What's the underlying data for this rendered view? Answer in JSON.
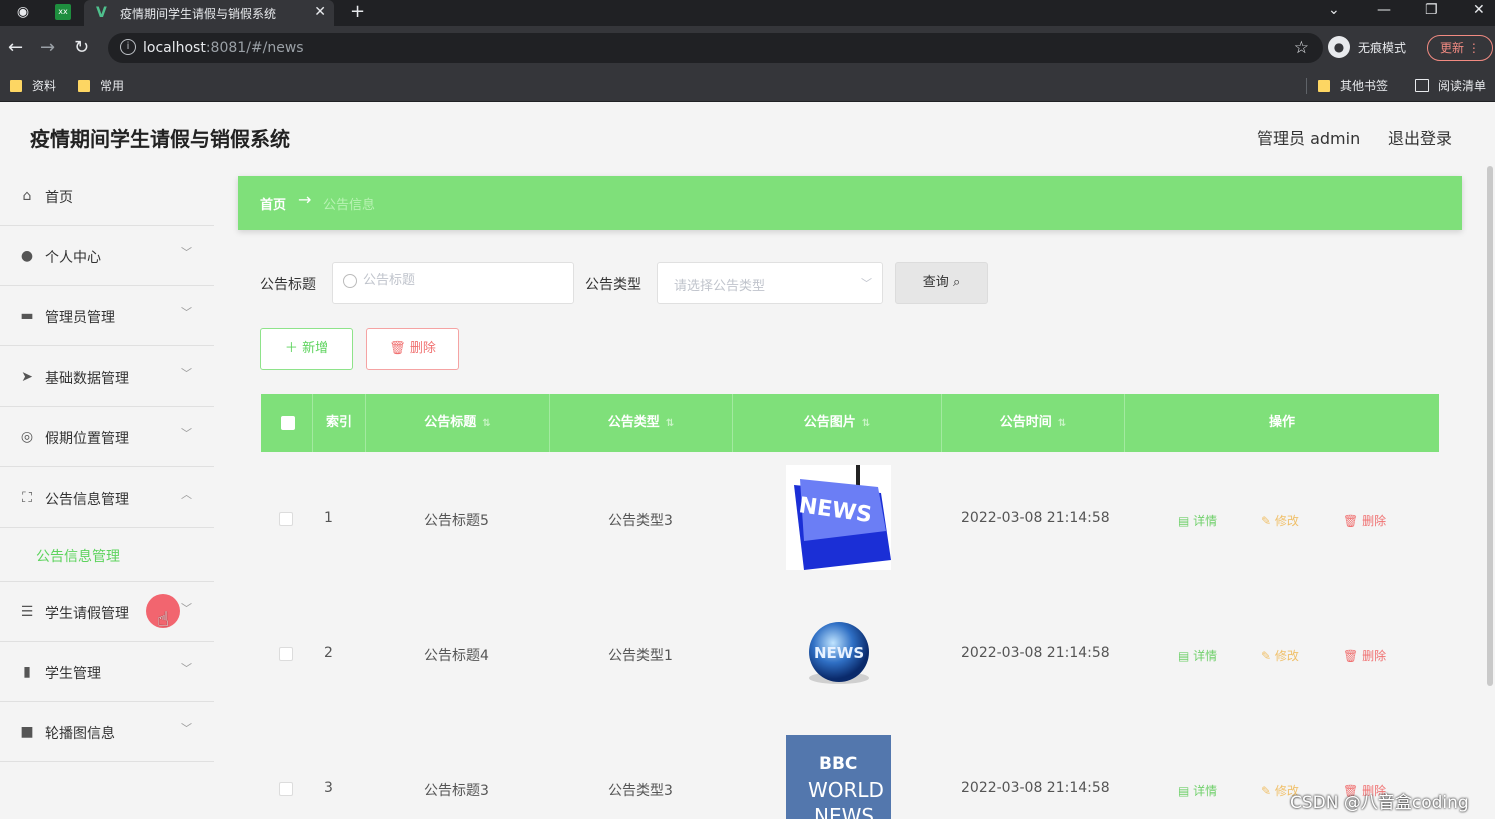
{
  "browser": {
    "tab_title": "疫情期间学生请假与销假系统",
    "tab_close": "✕",
    "new_tab": "+",
    "url_host": "localhost",
    "url_path": ":8081/#/news",
    "incognito_label": "无痕模式",
    "update_label": "更新",
    "bookmarks": {
      "left": [
        "资料",
        "常用"
      ],
      "right": [
        "其他书签",
        "阅读清单"
      ]
    },
    "accent": "#35363a"
  },
  "app": {
    "title": "疫情期间学生请假与销假系统",
    "admin_label": "管理员 admin",
    "logout_label": "退出登录",
    "theme_color": "#7fe07a"
  },
  "sidebar": {
    "items": [
      {
        "label": "首页",
        "icon": "home-icon"
      },
      {
        "label": "个人中心",
        "icon": "user-icon"
      },
      {
        "label": "管理员管理",
        "icon": "admin-icon"
      },
      {
        "label": "基础数据管理",
        "icon": "send-icon"
      },
      {
        "label": "假期位置管理",
        "icon": "location-icon"
      },
      {
        "label": "公告信息管理",
        "icon": "fullscreen-icon"
      },
      {
        "label": "学生请假管理",
        "icon": "sliders-icon"
      },
      {
        "label": "学生管理",
        "icon": "bar-chart-icon"
      },
      {
        "label": "轮播图信息",
        "icon": "video-icon"
      }
    ],
    "submenu": {
      "label": "公告信息管理"
    }
  },
  "breadcrumb": {
    "home": "首页",
    "arrow": "→",
    "current": "公告信息"
  },
  "search": {
    "title_label": "公告标题",
    "title_placeholder": "公告标题",
    "type_label": "公告类型",
    "type_placeholder": "请选择公告类型",
    "query_label": "查询"
  },
  "actions": {
    "add_label": "新增",
    "delete_label": "删除"
  },
  "table": {
    "columns": [
      "索引",
      "公告标题",
      "公告类型",
      "公告图片",
      "公告时间",
      "操作"
    ],
    "action_labels": {
      "detail": "详情",
      "edit": "修改",
      "delete": "删除"
    },
    "rows": [
      {
        "index": "1",
        "title": "公告标题5",
        "type": "公告类型3",
        "image": "news-keyboard-image",
        "time": "2022-03-08 21:14:58"
      },
      {
        "index": "2",
        "title": "公告标题4",
        "type": "公告类型1",
        "image": "news-globe-image",
        "time": "2022-03-08 21:14:58"
      },
      {
        "index": "3",
        "title": "公告标题3",
        "type": "公告类型3",
        "image": "bbc-world-news-image",
        "time": "2022-03-08 21:14:58"
      }
    ],
    "image_text": {
      "news_key": "NEWS",
      "globe": "NEWS",
      "bbc": "BBC",
      "bbc_world": "WORLD",
      "bbc_news": "NEWS"
    }
  },
  "watermark": "CSDN @八音盒coding"
}
